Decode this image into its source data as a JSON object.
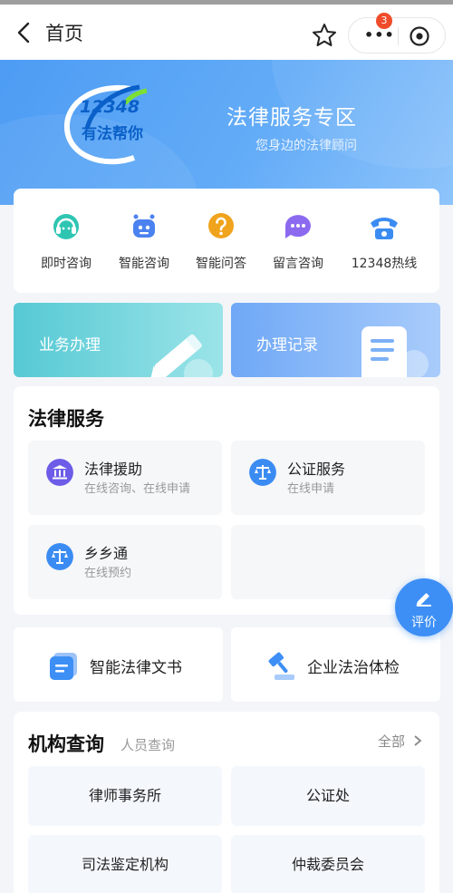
{
  "nav": {
    "title": "首页",
    "badge_count": "3"
  },
  "banner": {
    "logo_number": "12348",
    "logo_text": "有法帮你",
    "title": "法律服务专区",
    "subtitle": "您身边的法律顾问"
  },
  "consult": [
    {
      "label": "即时咨询",
      "icon": "headset-icon",
      "color": "#2fc5b3"
    },
    {
      "label": "智能咨询",
      "icon": "robot-icon",
      "color": "#4b82f0"
    },
    {
      "label": "智能问答",
      "icon": "question-icon",
      "color": "#f0a31c"
    },
    {
      "label": "留言咨询",
      "icon": "chat-icon",
      "color": "#8b6af0"
    },
    {
      "label": "12348热线",
      "icon": "phone-icon",
      "color": "#3b8cf2"
    }
  ],
  "quick": {
    "business": "业务办理",
    "records": "办理记录"
  },
  "services": {
    "title": "法律服务",
    "items": [
      {
        "title": "法律援助",
        "sub": "在线咨询、在线申请",
        "icon": "bank-icon",
        "color": "#6c5ce7"
      },
      {
        "title": "公证服务",
        "sub": "在线申请",
        "icon": "scale-icon",
        "color": "#3b8cf2"
      },
      {
        "title": "乡乡通",
        "sub": "在线预约",
        "icon": "scale-icon",
        "color": "#3b8cf2"
      }
    ]
  },
  "fab": {
    "label": "评价"
  },
  "tools": {
    "docs": "智能法律文书",
    "checkup": "企业法治体检"
  },
  "org": {
    "title": "机构查询",
    "subtitle": "人员查询",
    "all": "全部",
    "cells": [
      "律师事务所",
      "公证处",
      "司法鉴定机构",
      "仲裁委员会"
    ]
  },
  "colors": {
    "accent": "#3d8ff5",
    "teal": "#56c9d4"
  }
}
